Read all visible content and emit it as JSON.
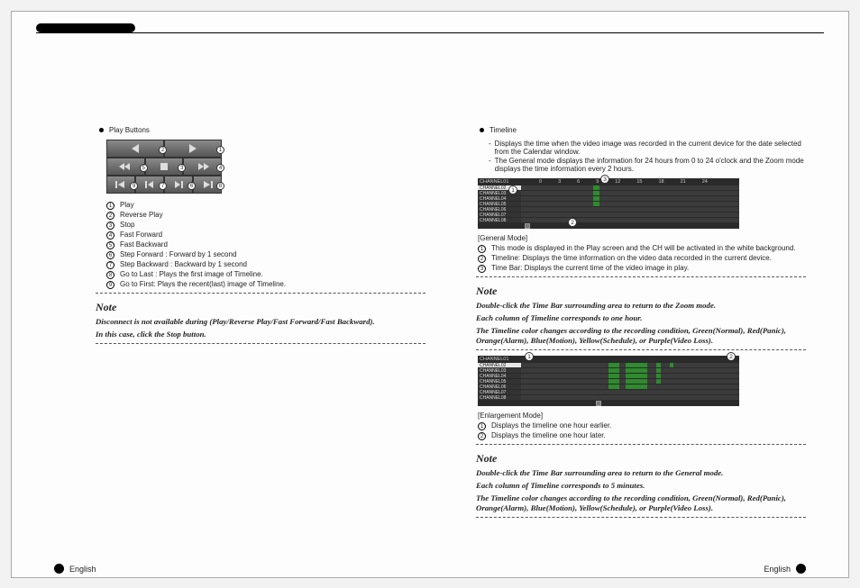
{
  "left": {
    "heading": "Play Buttons",
    "items": [
      "Play",
      "Reverse Play",
      "Stop",
      "Fast Forward",
      "Fast Backward",
      "Step Forward : Forward by 1 second",
      "Step Backward : Backward by 1 second",
      "Go to Last : Plays the first image of Timeline.",
      "Go to First: Plays the recent(last) image of Timeline."
    ],
    "note_title": "Note",
    "note_line1": "Disconnect is not available during (Play/Reverse Play/Fast Forward/Fast Backward).",
    "note_line2": "In this case, click the Stop button."
  },
  "right": {
    "heading": "Timeline",
    "desc1": "Displays the time when the video image was recorded in the current device for the date selected from the Calendar window.",
    "desc2": "The General mode displays the information for 24 hours from 0 to 24 o'clock and the Zoom mode displays the time information every 2 hours.",
    "timeline1_header": [
      "0",
      "3",
      "6",
      "9",
      "12",
      "15",
      "18",
      "21",
      "24"
    ],
    "channels": [
      "CHANNEL01",
      "CHANNEL02",
      "CHANNEL03",
      "CHANNEL04",
      "CHANNEL05",
      "CHANNEL06",
      "CHANNEL07",
      "CHANNEL08"
    ],
    "general_label": "[General Mode]",
    "general_items": [
      "This mode is displayed in the Play screen and the CH will be activated in the white background.",
      "Timeline: Displays the time information on the video data recorded in the current device.",
      "Time Bar: Displays the current time of the video image in play."
    ],
    "note1_title": "Note",
    "note1_line1": "Double-click the Time Bar surrounding area to return to the Zoom mode.",
    "note1_line2": "Each column of Timeline corresponds to one hour.",
    "note1_line3": "The Timeline color changes according to the recording condition, Green(Normal), Red(Panic), Orange(Alarm), Blue(Motion), Yellow(Schedule), or Purple(Video Loss).",
    "enlarge_label": "[Enlargement Mode]",
    "enlarge_items": [
      "Displays the timeline one hour earlier.",
      "Displays the timeline one hour later."
    ],
    "note2_title": "Note",
    "note2_line1": "Double-click the Time Bar surrounding area to return to the General mode.",
    "note2_line2": "Each column of Timeline corresponds to 5 minutes.",
    "note2_line3": "The Timeline color changes according to the recording condition, Green(Normal), Red(Panic), Orange(Alarm), Blue(Motion), Yellow(Schedule), or Purple(Video Loss)."
  },
  "footer": {
    "left": "English",
    "right": "English"
  }
}
